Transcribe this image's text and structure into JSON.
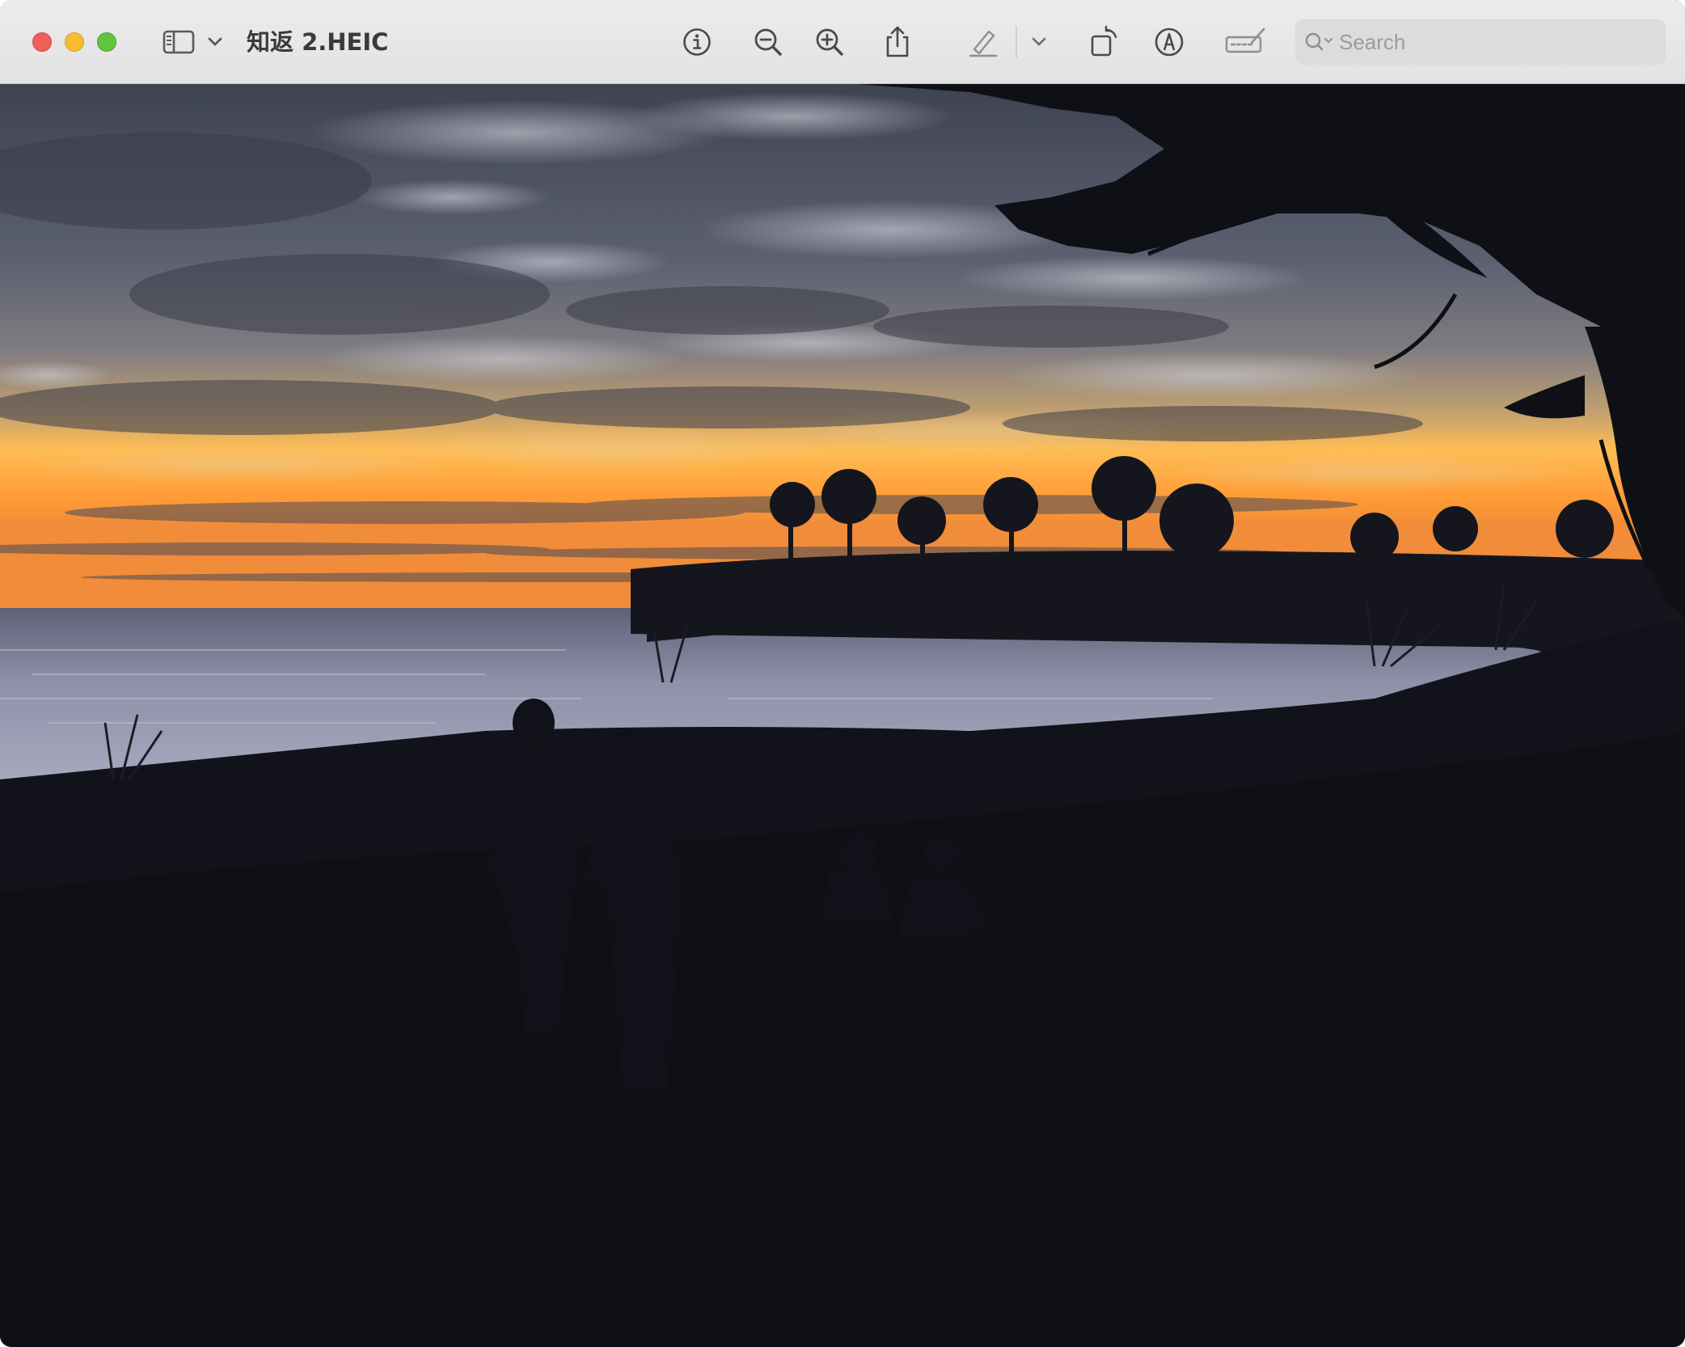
{
  "window": {
    "title": "知返 2.HEIC"
  },
  "toolbar": {
    "sidebar_icon": "sidebar-icon",
    "sidebar_menu_icon": "chevron-down-icon",
    "info_icon": "info-icon",
    "zoom_out_icon": "zoom-out-icon",
    "zoom_in_icon": "zoom-in-icon",
    "share_icon": "share-icon",
    "highlight_icon": "highlighter-icon",
    "highlight_menu_icon": "chevron-down-icon",
    "rotate_icon": "rotate-icon",
    "markup_icon": "markup-pen-icon",
    "signature_icon": "signature-icon"
  },
  "search": {
    "placeholder": "Search",
    "icon": "search-icon"
  },
  "colors": {
    "close": "#ee5f57",
    "minimize": "#f5bd2f",
    "zoom": "#5fc53f",
    "toolbar_bg": "#e5e5e7",
    "horizon_orange": "#ffa63c",
    "sky_cloud": "#5b6170",
    "sea": "#8a8ea6",
    "silhouette": "#12131a"
  },
  "image": {
    "description_icon": "photo-sunset-silhouettes"
  }
}
